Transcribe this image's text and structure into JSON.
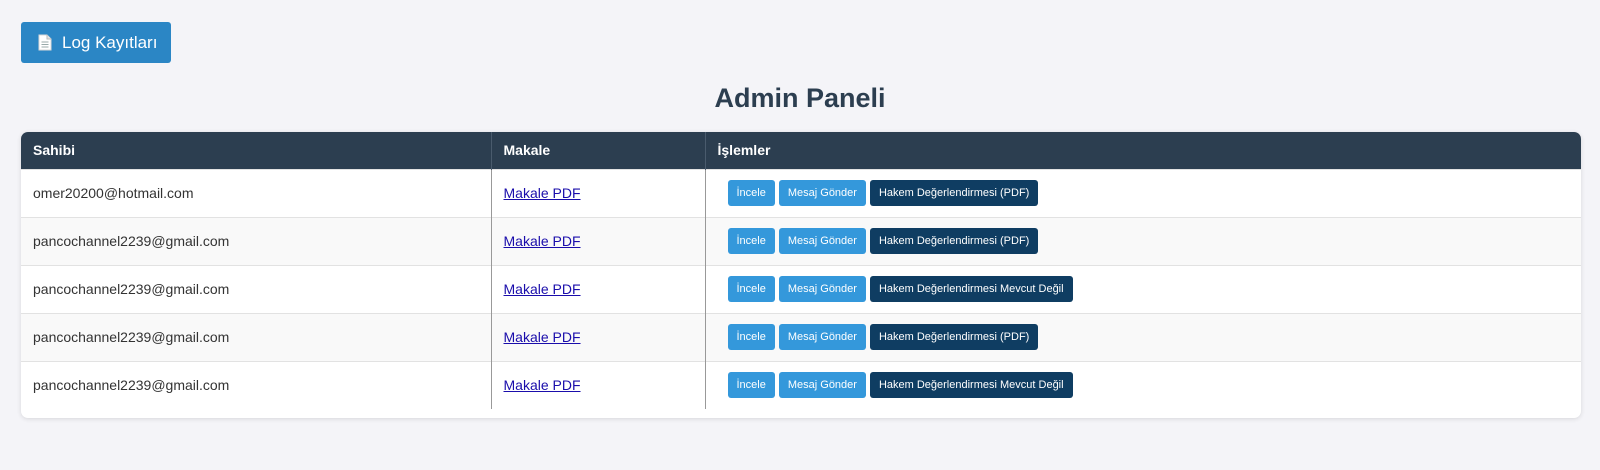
{
  "toolbar": {
    "log_button_label": "Log Kayıtları",
    "log_button_icon": "document-icon"
  },
  "page_title": "Admin Paneli",
  "table": {
    "headers": {
      "owner": "Sahibi",
      "article": "Makale",
      "actions": "İşlemler"
    },
    "rows": [
      {
        "owner": "omer20200@hotmail.com",
        "article_link": "Makale PDF",
        "review_label": "İncele",
        "message_label": "Mesaj Gönder",
        "referee_label": "Hakem Değerlendirmesi (PDF)"
      },
      {
        "owner": "pancochannel2239@gmail.com",
        "article_link": "Makale PDF",
        "review_label": "İncele",
        "message_label": "Mesaj Gönder",
        "referee_label": "Hakem Değerlendirmesi (PDF)"
      },
      {
        "owner": "pancochannel2239@gmail.com",
        "article_link": "Makale PDF",
        "review_label": "İncele",
        "message_label": "Mesaj Gönder",
        "referee_label": "Hakem Değerlendirmesi Mevcut Değil"
      },
      {
        "owner": "pancochannel2239@gmail.com",
        "article_link": "Makale PDF",
        "review_label": "İncele",
        "message_label": "Mesaj Gönder",
        "referee_label": "Hakem Değerlendirmesi (PDF)"
      },
      {
        "owner": "pancochannel2239@gmail.com",
        "article_link": "Makale PDF",
        "review_label": "İncele",
        "message_label": "Mesaj Gönder",
        "referee_label": "Hakem Değerlendirmesi Mevcut Değil"
      }
    ]
  },
  "colors": {
    "log_button": "#2b86c5",
    "header_bg": "#2c3e50",
    "action_light": "#3498db",
    "action_dark": "#0f3d62",
    "link": "#1a0dab"
  }
}
